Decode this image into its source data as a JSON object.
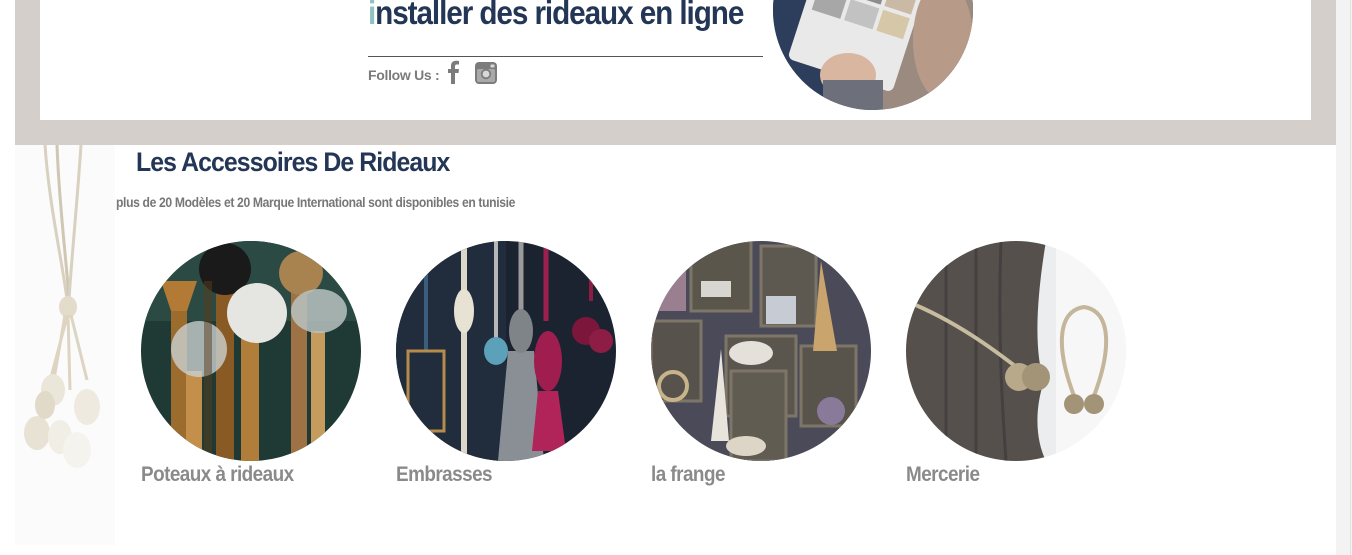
{
  "banner": {
    "title_first_letter": "i",
    "title_rest": "nstaller des rideaux en ligne",
    "follow_label": "Follow Us :",
    "social": [
      {
        "icon": "facebook-icon"
      },
      {
        "icon": "instagram-icon"
      }
    ],
    "photo_icon": "tablet-catalog-photo"
  },
  "section": {
    "title": "Les Accessoires De Rideaux",
    "subtitle": "plus de 20 Modèles et 20 Marque International sont disponibles en tunisie"
  },
  "categories": [
    {
      "label": "Poteaux à rideaux",
      "image": "curtain-rod-finials-photo"
    },
    {
      "label": "Embrasses",
      "image": "tassel-tiebacks-photo"
    },
    {
      "label": "la frange",
      "image": "fringe-trims-shelf-photo"
    },
    {
      "label": "Mercerie",
      "image": "magnetic-tieback-photo"
    }
  ],
  "colors": {
    "navy": "#243656",
    "teal_accent": "#8fc3bf",
    "frame_beige": "#d4cfcb",
    "label_grey": "#8a8a8a"
  }
}
